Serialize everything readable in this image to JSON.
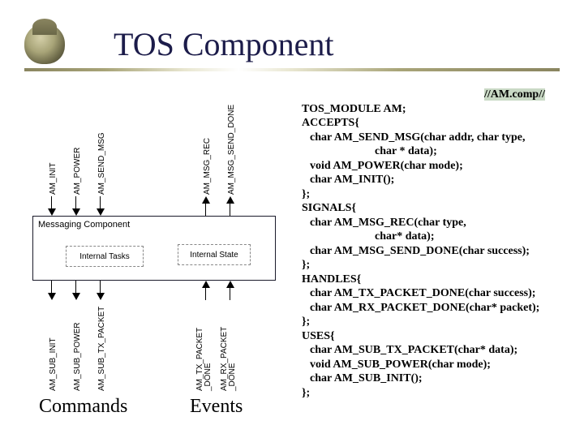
{
  "title": "TOS Component",
  "top_arrows": {
    "commands": [
      "AM_INIT",
      "AM_POWER",
      "AM_SEND_MSG"
    ],
    "events": [
      "AM_MSG_REC",
      "AM_MSG_SEND_DONE"
    ]
  },
  "component": {
    "title": "Messaging Component",
    "tasks": "Internal Tasks",
    "state": "Internal State"
  },
  "bottom_arrows": {
    "commands": [
      "AM_SUB_INIT",
      "AM_SUB_POWER",
      "AM_SUB_TX_PACKET"
    ],
    "events": [
      "AM_TX_PACKET\n_DONE",
      "AM_RX_PACKET\n_DONE"
    ]
  },
  "labels": {
    "commands": "Commands",
    "events": "Events"
  },
  "code": {
    "l0": "//AM.comp//",
    "l1": "TOS_MODULE AM;",
    "l2": "ACCEPTS{",
    "l3": "char AM_SEND_MSG(char addr, char type,",
    "l4": "char * data);",
    "l5": "void AM_POWER(char mode);",
    "l6": "char AM_INIT();",
    "l7": "};",
    "l8": "SIGNALS{",
    "l9": "char AM_MSG_REC(char type,",
    "l10": "char* data);",
    "l11": "char AM_MSG_SEND_DONE(char success);",
    "l12": "};",
    "l13": "HANDLES{",
    "l14": "char AM_TX_PACKET_DONE(char success);",
    "l15": "char AM_RX_PACKET_DONE(char* packet);",
    "l16": "};",
    "l17": "USES{",
    "l18": "char AM_SUB_TX_PACKET(char* data);",
    "l19": "void AM_SUB_POWER(char mode);",
    "l20": "char AM_SUB_INIT();",
    "l21": "};"
  }
}
